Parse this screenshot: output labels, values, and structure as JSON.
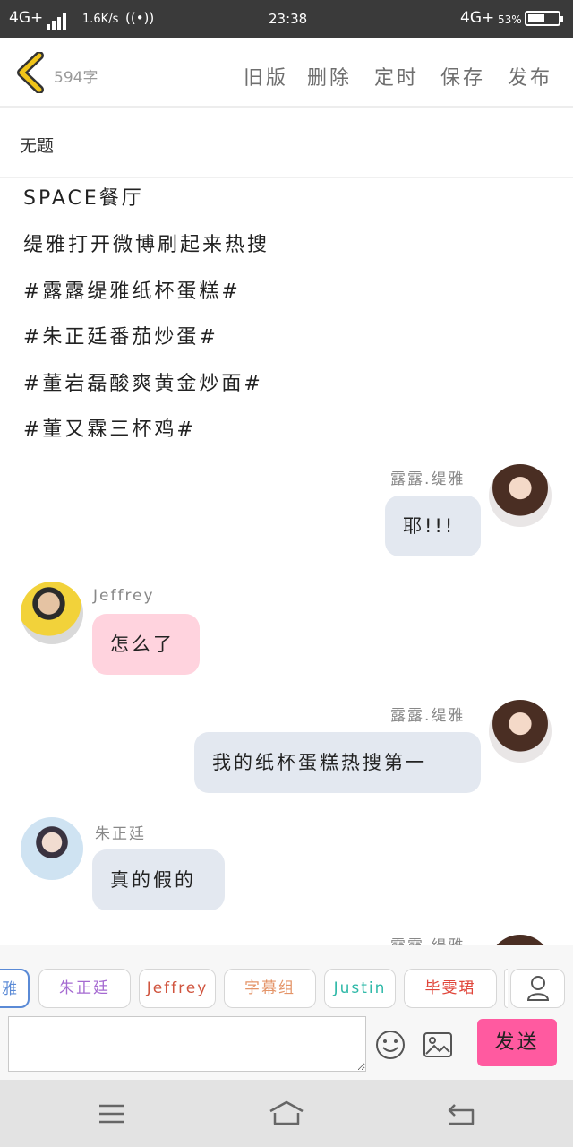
{
  "status_bar": {
    "network_left": "4G+",
    "speed": "1.6K/s",
    "time": "23:38",
    "network_right": "4G+",
    "battery": "53%"
  },
  "toolbar": {
    "word_count": "594字",
    "buttons": [
      "旧版",
      "删除",
      "定时",
      "保存",
      "发布"
    ]
  },
  "doc": {
    "title": "无题",
    "lines": [
      "SPACE餐厅",
      "缇雅打开微博刷起来热搜",
      "#露露缇雅纸杯蛋糕#",
      "#朱正廷番茄炒蛋#",
      "#董岩磊酸爽黄金炒面#",
      "#董又霖三杯鸡#"
    ]
  },
  "messages": [
    {
      "side": "right",
      "name": "露露.缇雅",
      "text": "耶!!!"
    },
    {
      "side": "left",
      "name": "Jeffrey",
      "text": "怎么了"
    },
    {
      "side": "right",
      "name": "露露.缇雅",
      "text": "我的纸杯蛋糕热搜第一"
    },
    {
      "side": "left",
      "name": "朱正廷",
      "text": "真的假的"
    },
    {
      "side": "right",
      "name": "露露.缇雅",
      "text": ""
    }
  ],
  "role_bar": {
    "chips": [
      "雅",
      "朱正廷",
      "Jeffrey",
      "字幕组",
      "Justin",
      "毕雯珺"
    ],
    "chip_colors": [
      "#5a8ad6",
      "#a56ad1",
      "#d0553f",
      "#e49468",
      "#2fb9a8",
      "#e0453a"
    ]
  },
  "composer": {
    "input_value": "",
    "send_label": "发送"
  },
  "colors": {
    "accent": "#ff5aa0",
    "bubble_gray": "#e3e8f0",
    "bubble_pink": "#ffd3de",
    "back_arrow": "#f0c419"
  }
}
